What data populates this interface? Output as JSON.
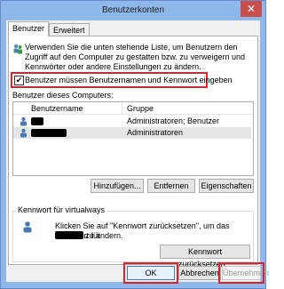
{
  "window": {
    "title": "Benutzerkonten",
    "close_symbol": "✕"
  },
  "tabs": [
    {
      "label": "Benutzer"
    },
    {
      "label": "Erweitert"
    }
  ],
  "intro_text": "Verwenden Sie die unten stehende Liste, um Benutzern den Zugriff auf den Computer zu gestatten bzw. zu verweigern und Kennwörter oder andere Einstellungen zu ändern.",
  "checkbox": {
    "label": "Benutzer müssen Benutzernamen und Kennwort eingeben",
    "checked": true,
    "mark": "✔"
  },
  "users_heading": "Benutzer dieses Computers:",
  "table": {
    "columns": [
      "Benutzername",
      "Gruppe"
    ],
    "rows": [
      {
        "name": "",
        "group": "Administratoren; Benutzer"
      },
      {
        "name": "",
        "group": "Administratoren"
      }
    ]
  },
  "buttons": {
    "add": "Hinzufügen...",
    "remove": "Entfernen",
    "properties": "Eigenschaften"
  },
  "password_group": {
    "legend": "Kennwort für virtualways",
    "text": "Klicken Sie auf \"Kennwort zurücksetzen\", um das Kennwort für",
    "text2": "zu ändern.",
    "button": "Kennwort zurücksetzen..."
  },
  "dialog_buttons": {
    "ok": "OK",
    "cancel": "Abbrechen",
    "apply": "Übernehmen"
  },
  "colors": {
    "highlight": "#e0202a",
    "titlebar": "#8eb7ea",
    "close": "#c94e4e"
  }
}
